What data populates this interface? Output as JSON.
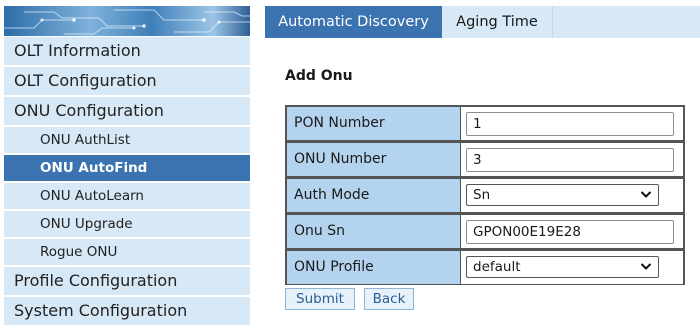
{
  "sidebar": {
    "items": [
      {
        "label": "OLT Information"
      },
      {
        "label": "OLT Configuration"
      },
      {
        "label": "ONU Configuration"
      },
      {
        "label": "ONU AuthList"
      },
      {
        "label": "ONU AutoFind"
      },
      {
        "label": "ONU AutoLearn"
      },
      {
        "label": "ONU Upgrade"
      },
      {
        "label": "Rogue ONU"
      },
      {
        "label": "Profile Configuration"
      },
      {
        "label": "System Configuration"
      }
    ],
    "active_item": "ONU AutoFind"
  },
  "tabs": [
    {
      "label": "Automatic Discovery",
      "active": true
    },
    {
      "label": "Aging Time",
      "active": false
    }
  ],
  "main": {
    "title": "Add Onu",
    "form": {
      "pon_number": {
        "label": "PON Number",
        "value": "1"
      },
      "onu_number": {
        "label": "ONU Number",
        "value": "3"
      },
      "auth_mode": {
        "label": "Auth Mode",
        "value": "Sn"
      },
      "onu_sn": {
        "label": "Onu Sn",
        "value": "GPON00E19E28"
      },
      "onu_profile": {
        "label": "ONU Profile",
        "value": "default"
      }
    },
    "buttons": {
      "submit": "Submit",
      "back": "Back"
    }
  },
  "colors": {
    "accent": "#3b72b0",
    "menu_bg": "#d7e8f6",
    "label_cell_bg": "#b4d3ee",
    "button_text": "#2a5e93"
  },
  "icons": [
    "chevron-down-icon"
  ]
}
